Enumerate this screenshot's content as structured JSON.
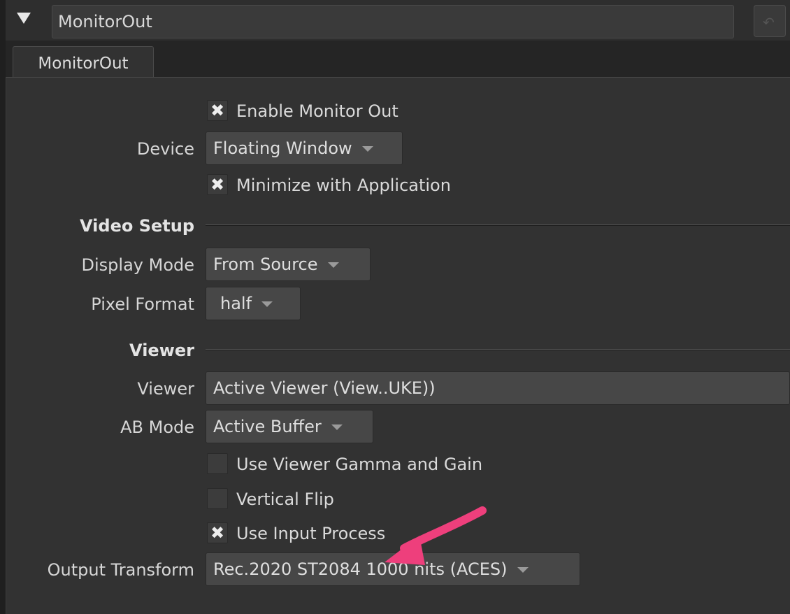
{
  "header": {
    "node_name": "MonitorOut",
    "collapse_icon": "triangle-down-icon",
    "revert_icon": "revert-icon"
  },
  "tabs": [
    {
      "label": "MonitorOut"
    }
  ],
  "monitor": {
    "enable_monitor_out": {
      "label": "Enable Monitor Out",
      "checked": true
    },
    "device": {
      "label": "Device",
      "value": "Floating Window"
    },
    "minimize_with_application": {
      "label": "Minimize with Application",
      "checked": true
    }
  },
  "video_setup": {
    "title": "Video Setup",
    "display_mode": {
      "label": "Display Mode",
      "value": "From Source"
    },
    "pixel_format": {
      "label": "Pixel Format",
      "value": "half"
    }
  },
  "viewer_section": {
    "title": "Viewer",
    "viewer": {
      "label": "Viewer",
      "value": "Active Viewer (View..UKE))"
    },
    "ab_mode": {
      "label": "AB Mode",
      "value": "Active Buffer"
    },
    "use_viewer_gamma_gain": {
      "label": "Use Viewer Gamma and Gain",
      "checked": false
    },
    "vertical_flip": {
      "label": "Vertical Flip",
      "checked": false
    },
    "use_input_process": {
      "label": "Use Input Process",
      "checked": true
    },
    "output_transform": {
      "label": "Output Transform",
      "value": "Rec.2020 ST2084 1000 nits (ACES)"
    }
  },
  "annotation": {
    "arrow_color": "#ee3f7c"
  },
  "check_glyph": "✖"
}
